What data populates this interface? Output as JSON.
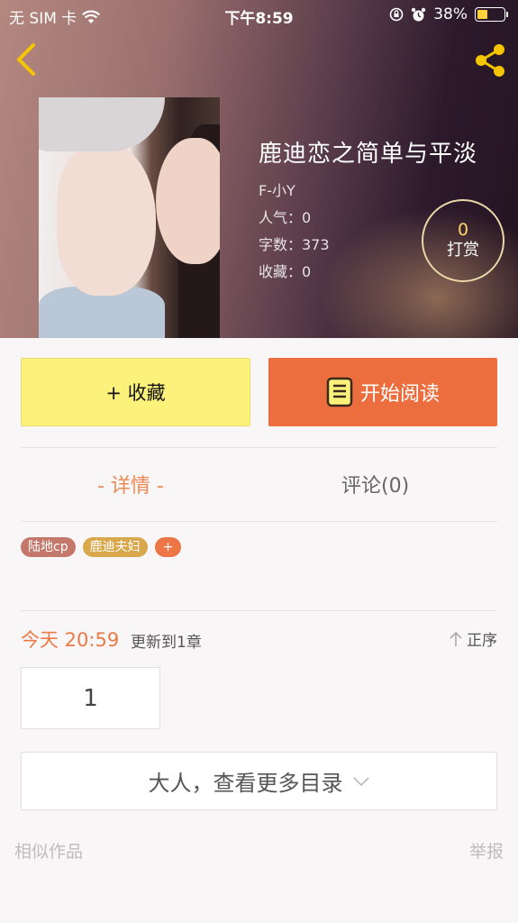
{
  "status_bar": {
    "carrier": "无 SIM 卡",
    "time": "下午8:59",
    "battery_percent": "38%",
    "battery_level": 0.38,
    "battery_color": "#ffd23c"
  },
  "header": {
    "back_icon": "chevron-left-icon",
    "share_icon": "share-icon",
    "icon_color": "#f5c600"
  },
  "book": {
    "title": "鹿迪恋之简单与平淡",
    "author": "F-小Y",
    "popularity": "人气：0",
    "word_count": "字数：373",
    "favorites": "收藏：0"
  },
  "reward": {
    "count": "0",
    "label": "打赏"
  },
  "actions": {
    "collect_label": "+ 收藏",
    "read_label": "开始阅读",
    "collect_color": "#fcf27b",
    "read_color": "#ec6d3d"
  },
  "tabs": {
    "detail": "- 详情 -",
    "comments": "评论(0)",
    "active_color": "#ec8a56"
  },
  "tags": [
    {
      "label": "陆地cp"
    },
    {
      "label": "鹿迪夫妇"
    },
    {
      "label": "+"
    }
  ],
  "update": {
    "time": "今天 20:59",
    "text": "更新到1章",
    "order_label": "正序"
  },
  "chapters": [
    "1"
  ],
  "more_catalog": "大人，查看更多目录",
  "footer": {
    "similar": "相似作品",
    "report": "举报"
  }
}
